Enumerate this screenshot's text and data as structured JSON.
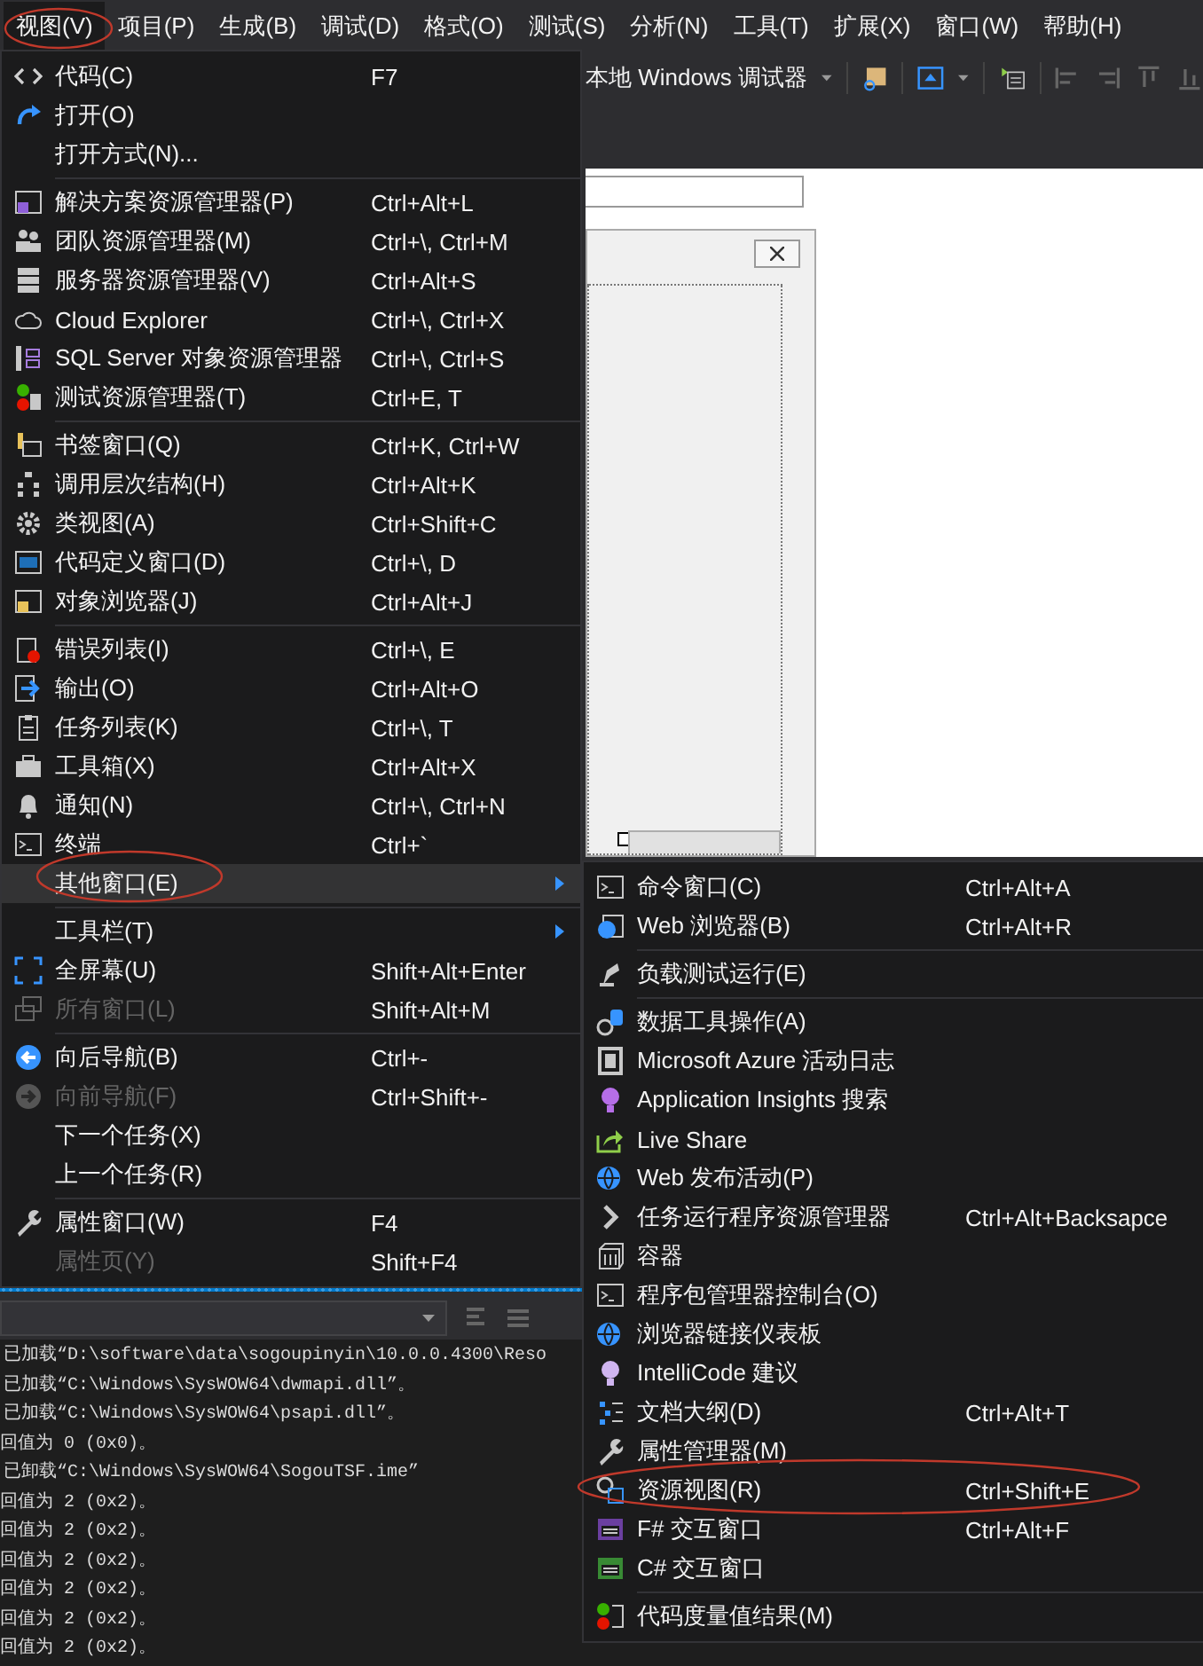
{
  "menubar": [
    {
      "label": "视图(V)",
      "selected": true
    },
    {
      "label": "项目(P)",
      "selected": false
    },
    {
      "label": "生成(B)",
      "selected": false
    },
    {
      "label": "调试(D)",
      "selected": false
    },
    {
      "label": "格式(O)",
      "selected": false
    },
    {
      "label": "测试(S)",
      "selected": false
    },
    {
      "label": "分析(N)",
      "selected": false
    },
    {
      "label": "工具(T)",
      "selected": false
    },
    {
      "label": "扩展(X)",
      "selected": false
    },
    {
      "label": "窗口(W)",
      "selected": false
    },
    {
      "label": "帮助(H)",
      "selected": false
    }
  ],
  "toolbar": {
    "debugger": "本地 Windows 调试器"
  },
  "view_menu": {
    "items": [
      {
        "kind": "item",
        "label": "代码(C)",
        "shortcut": "F7",
        "disabled": false,
        "selected": false,
        "has_submenu": false
      },
      {
        "kind": "item",
        "label": "打开(O)",
        "disabled": false,
        "selected": false,
        "has_submenu": false
      },
      {
        "kind": "item",
        "label": "打开方式(N)...",
        "disabled": false,
        "selected": false,
        "has_submenu": false
      },
      {
        "kind": "separator"
      },
      {
        "kind": "item",
        "label": "解决方案资源管理器(P)",
        "shortcut": "Ctrl+Alt+L",
        "disabled": false,
        "selected": false,
        "has_submenu": false
      },
      {
        "kind": "item",
        "label": "团队资源管理器(M)",
        "shortcut": "Ctrl+\\, Ctrl+M",
        "disabled": false,
        "selected": false,
        "has_submenu": false
      },
      {
        "kind": "item",
        "label": "服务器资源管理器(V)",
        "shortcut": "Ctrl+Alt+S",
        "disabled": false,
        "selected": false,
        "has_submenu": false
      },
      {
        "kind": "item",
        "label": "Cloud Explorer",
        "shortcut": "Ctrl+\\, Ctrl+X",
        "disabled": false,
        "selected": false,
        "has_submenu": false
      },
      {
        "kind": "item",
        "label": "SQL Server 对象资源管理器",
        "shortcut": "Ctrl+\\, Ctrl+S",
        "disabled": false,
        "selected": false,
        "has_submenu": false
      },
      {
        "kind": "item",
        "label": "测试资源管理器(T)",
        "shortcut": "Ctrl+E, T",
        "disabled": false,
        "selected": false,
        "has_submenu": false
      },
      {
        "kind": "separator"
      },
      {
        "kind": "item",
        "label": "书签窗口(Q)",
        "shortcut": "Ctrl+K, Ctrl+W",
        "disabled": false,
        "selected": false,
        "has_submenu": false
      },
      {
        "kind": "item",
        "label": "调用层次结构(H)",
        "shortcut": "Ctrl+Alt+K",
        "disabled": false,
        "selected": false,
        "has_submenu": false
      },
      {
        "kind": "item",
        "label": "类视图(A)",
        "shortcut": "Ctrl+Shift+C",
        "disabled": false,
        "selected": false,
        "has_submenu": false
      },
      {
        "kind": "item",
        "label": "代码定义窗口(D)",
        "shortcut": "Ctrl+\\, D",
        "disabled": false,
        "selected": false,
        "has_submenu": false
      },
      {
        "kind": "item",
        "label": "对象浏览器(J)",
        "shortcut": "Ctrl+Alt+J",
        "disabled": false,
        "selected": false,
        "has_submenu": false
      },
      {
        "kind": "separator"
      },
      {
        "kind": "item",
        "label": "错误列表(I)",
        "shortcut": "Ctrl+\\, E",
        "disabled": false,
        "selected": false,
        "has_submenu": false
      },
      {
        "kind": "item",
        "label": "输出(O)",
        "shortcut": "Ctrl+Alt+O",
        "disabled": false,
        "selected": false,
        "has_submenu": false
      },
      {
        "kind": "item",
        "label": "任务列表(K)",
        "shortcut": "Ctrl+\\, T",
        "disabled": false,
        "selected": false,
        "has_submenu": false
      },
      {
        "kind": "item",
        "label": "工具箱(X)",
        "shortcut": "Ctrl+Alt+X",
        "disabled": false,
        "selected": false,
        "has_submenu": false
      },
      {
        "kind": "item",
        "label": "通知(N)",
        "shortcut": "Ctrl+\\, Ctrl+N",
        "disabled": false,
        "selected": false,
        "has_submenu": false
      },
      {
        "kind": "item",
        "label": "终端",
        "shortcut": "Ctrl+`",
        "disabled": false,
        "selected": false,
        "has_submenu": false
      },
      {
        "kind": "item",
        "label": "其他窗口(E)",
        "disabled": false,
        "selected": true,
        "has_submenu": true
      },
      {
        "kind": "separator"
      },
      {
        "kind": "item",
        "label": "工具栏(T)",
        "disabled": false,
        "selected": false,
        "has_submenu": true
      },
      {
        "kind": "item",
        "label": "全屏幕(U)",
        "shortcut": "Shift+Alt+Enter",
        "disabled": false,
        "selected": false,
        "has_submenu": false
      },
      {
        "kind": "item",
        "label": "所有窗口(L)",
        "shortcut": "Shift+Alt+M",
        "disabled": true,
        "selected": false,
        "has_submenu": false
      },
      {
        "kind": "separator"
      },
      {
        "kind": "item",
        "label": "向后导航(B)",
        "shortcut": "Ctrl+-",
        "disabled": false,
        "selected": false,
        "has_submenu": false
      },
      {
        "kind": "item",
        "label": "向前导航(F)",
        "shortcut": "Ctrl+Shift+-",
        "disabled": true,
        "selected": false,
        "has_submenu": false
      },
      {
        "kind": "item",
        "label": "下一个任务(X)",
        "disabled": false,
        "selected": false,
        "has_submenu": false
      },
      {
        "kind": "item",
        "label": "上一个任务(R)",
        "disabled": false,
        "selected": false,
        "has_submenu": false
      },
      {
        "kind": "separator"
      },
      {
        "kind": "item",
        "label": "属性窗口(W)",
        "shortcut": "F4",
        "disabled": false,
        "selected": false,
        "has_submenu": false
      },
      {
        "kind": "item",
        "label": "属性页(Y)",
        "shortcut": "Shift+F4",
        "disabled": true,
        "selected": false,
        "has_submenu": false
      }
    ]
  },
  "other_windows_menu": {
    "items": [
      {
        "kind": "item",
        "label": "命令窗口(C)",
        "shortcut": "Ctrl+Alt+A"
      },
      {
        "kind": "item",
        "label": "Web 浏览器(B)",
        "shortcut": "Ctrl+Alt+R"
      },
      {
        "kind": "separator"
      },
      {
        "kind": "item",
        "label": "负载测试运行(E)"
      },
      {
        "kind": "separator"
      },
      {
        "kind": "item",
        "label": "数据工具操作(A)"
      },
      {
        "kind": "item",
        "label": "Microsoft Azure 活动日志"
      },
      {
        "kind": "item",
        "label": "Application Insights 搜索"
      },
      {
        "kind": "item",
        "label": "Live Share"
      },
      {
        "kind": "item",
        "label": "Web 发布活动(P)"
      },
      {
        "kind": "item",
        "label": "任务运行程序资源管理器",
        "shortcut": "Ctrl+Alt+Backsapce"
      },
      {
        "kind": "item",
        "label": "容器"
      },
      {
        "kind": "item",
        "label": "程序包管理器控制台(O)"
      },
      {
        "kind": "item",
        "label": "浏览器链接仪表板"
      },
      {
        "kind": "item",
        "label": "IntelliCode 建议"
      },
      {
        "kind": "item",
        "label": "文档大纲(D)",
        "shortcut": "Ctrl+Alt+T"
      },
      {
        "kind": "item",
        "label": "属性管理器(M)"
      },
      {
        "kind": "item",
        "label": "资源视图(R)",
        "shortcut": "Ctrl+Shift+E"
      },
      {
        "kind": "item",
        "label": "F# 交互窗口",
        "shortcut": "Ctrl+Alt+F"
      },
      {
        "kind": "item",
        "label": "C# 交互窗口"
      },
      {
        "kind": "separator"
      },
      {
        "kind": "item",
        "label": "代码度量值结果(M)"
      }
    ]
  },
  "output": {
    "lines": [
      "已加载“D:\\software\\data\\sogoupinyin\\10.0.0.4300\\Reso",
      "已加载“C:\\Windows\\SysWOW64\\dwmapi.dll”。",
      "已加载“C:\\Windows\\SysWOW64\\psapi.dll”。",
      "回值为 0 (0x0)。",
      "已卸载“C:\\Windows\\SysWOW64\\SogouTSF.ime”",
      "回值为 2 (0x2)。",
      "回值为 2 (0x2)。",
      "回值为 2 (0x2)。",
      "回值为 2 (0x2)。",
      "回值为 2 (0x2)。",
      "回值为 2 (0x2)。"
    ]
  }
}
